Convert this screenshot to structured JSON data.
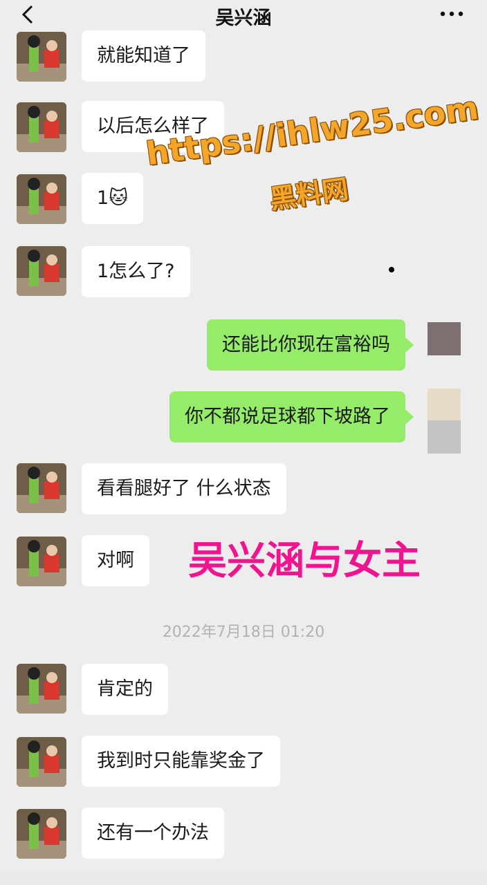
{
  "header": {
    "title": "吴兴涵",
    "back_icon": "chevron-left-icon",
    "more_icon": "more-dots-icon"
  },
  "messages": [
    {
      "side": "left",
      "text": "就能知道了"
    },
    {
      "side": "left",
      "text": "以后怎么样了"
    },
    {
      "side": "left",
      "text": "1🐱"
    },
    {
      "side": "left",
      "text": "1怎么了?"
    },
    {
      "side": "right",
      "text": "还能比你现在富裕吗"
    },
    {
      "side": "right",
      "text": "你不都说足球都下坡路了"
    },
    {
      "side": "left",
      "text": "看看腿好了 什么状态"
    },
    {
      "side": "left",
      "text": "对啊"
    },
    {
      "side": "left",
      "text": "肯定的"
    },
    {
      "side": "left",
      "text": "我到时只能靠奖金了"
    },
    {
      "side": "left",
      "text": "还有一个办法"
    }
  ],
  "timestamp": "2022年7月18日 01:20",
  "watermark": {
    "url": "https://ihlw25.com",
    "name": "黑料网"
  },
  "overlay_caption": "吴兴涵与女主",
  "colors": {
    "self_bubble": "#95ec69",
    "other_bubble": "#ffffff",
    "background": "#ededed",
    "caption": "#f0158e",
    "watermark": "#f4a62a"
  }
}
